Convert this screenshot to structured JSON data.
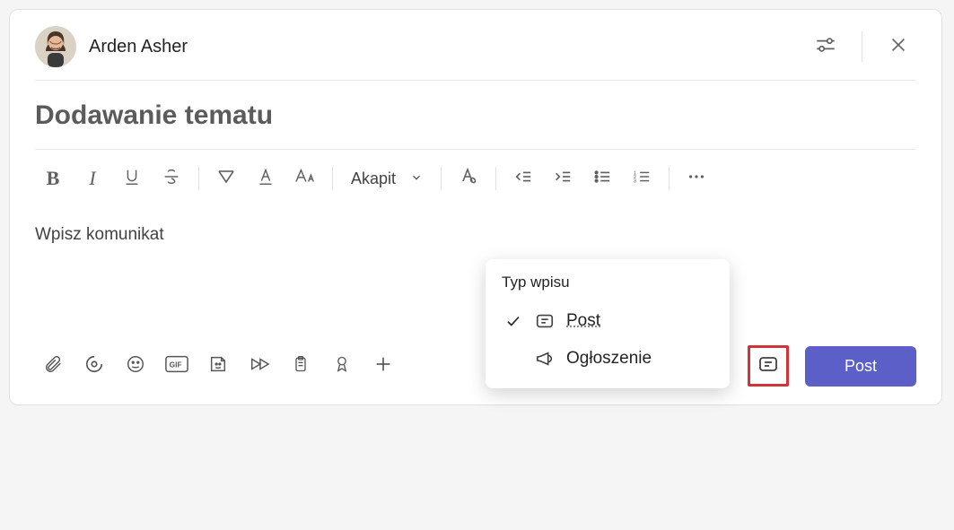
{
  "author": {
    "name": "Arden Asher"
  },
  "subject": {
    "placeholder": "Dodawanie tematu"
  },
  "paragraph_select": {
    "label": "Akapit"
  },
  "message": {
    "placeholder": "Wpisz komunikat"
  },
  "post_type_menu": {
    "title": "Typ wpisu",
    "items": [
      {
        "label": "Post",
        "selected": true
      },
      {
        "label": "Ogłoszenie",
        "selected": false
      }
    ]
  },
  "submit": {
    "label": "Post"
  },
  "icons": {
    "settings": "settings-sliders-icon",
    "close": "close-icon",
    "bold": "bold-icon",
    "italic": "italic-icon",
    "underline": "underline-icon",
    "strike": "strikethrough-icon",
    "highlighter": "highlighter-icon",
    "font_color": "font-color-icon",
    "font_size": "font-size-icon",
    "clear_format": "clear-format-icon",
    "outdent": "outdent-icon",
    "indent": "indent-icon",
    "bullets": "bulleted-list-icon",
    "numbers": "numbered-list-icon",
    "more": "more-options-icon",
    "attach": "attach-icon",
    "loop": "loop-icon",
    "emoji": "emoji-icon",
    "gif": "gif-icon",
    "sticker": "sticker-icon",
    "stream": "stream-icon",
    "clipboard": "clipboard-icon",
    "praise": "praise-icon",
    "add_ext": "add-extension-icon",
    "post_type": "post-type-icon",
    "check": "checkmark-icon",
    "post_icon": "post-icon",
    "announcement": "announcement-icon"
  }
}
